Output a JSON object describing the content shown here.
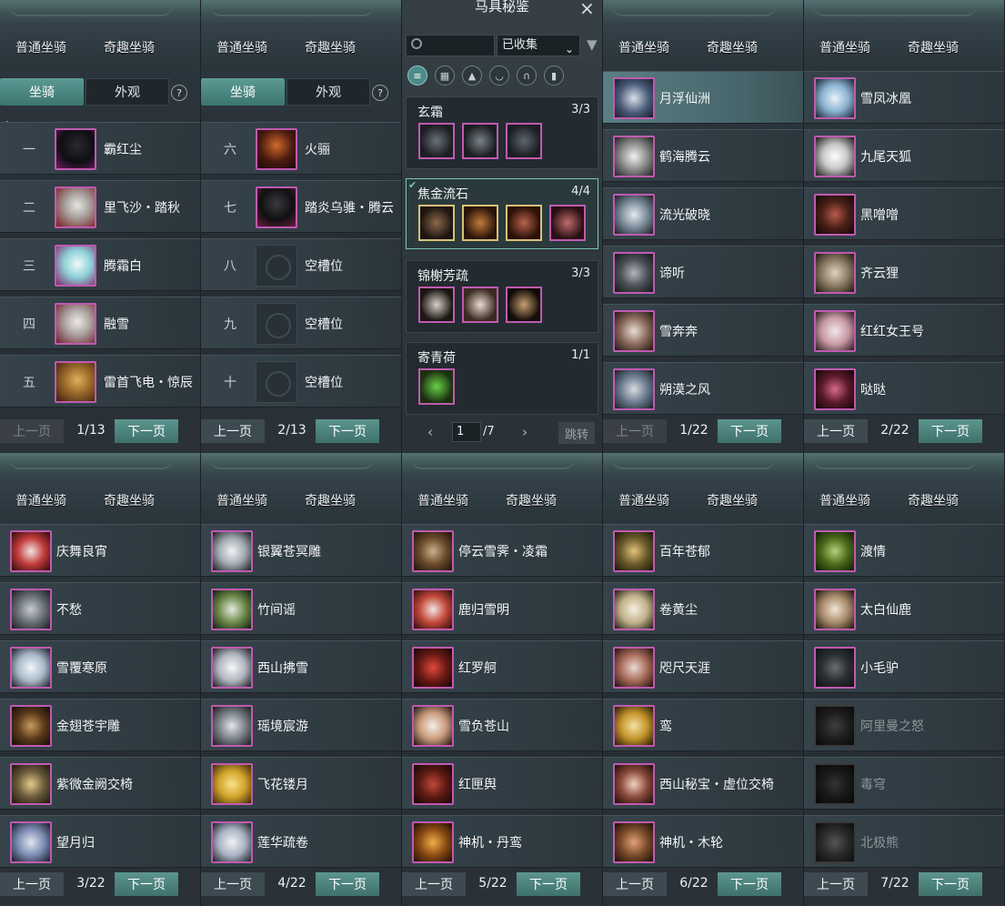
{
  "colors": {
    "accent": "#4f8a8a",
    "border_epic": "#c05ab0",
    "border_gold": "#d7c07a"
  },
  "common": {
    "tab_normal": "普通坐骑",
    "tab_fun": "奇趣坐骑",
    "sub_mount": "坐骑",
    "sub_look": "外观",
    "help": "?",
    "prev": "上一页",
    "next": "下一页"
  },
  "panels": [
    {
      "page": "1/13",
      "prev_disabled": true,
      "slots": [
        {
          "num": "一",
          "name": "霸红尘"
        },
        {
          "num": "二",
          "name": "里飞沙・踏秋"
        },
        {
          "num": "三",
          "name": "腾霜白"
        },
        {
          "num": "四",
          "name": "融雪"
        },
        {
          "num": "五",
          "name": "雷首飞电・惊辰"
        }
      ]
    },
    {
      "page": "2/13",
      "prev_disabled": false,
      "slots": [
        {
          "num": "六",
          "name": "火骊"
        },
        {
          "num": "七",
          "name": "踏炎乌骓・腾云"
        },
        {
          "num": "八",
          "name": "空槽位"
        },
        {
          "num": "九",
          "name": "空槽位"
        },
        {
          "num": "十",
          "name": "空槽位"
        }
      ]
    },
    {
      "page": "1/22",
      "prev_disabled": true,
      "items": [
        "月浮仙洲",
        "鹤海腾云",
        "流光破晓",
        "谛听",
        "雪奔奔",
        "朔漠之风"
      ]
    },
    {
      "page": "2/22",
      "prev_disabled": false,
      "items": [
        "雪凤冰凰",
        "九尾天狐",
        "黑噌噌",
        "齐云狸",
        "红红女王号",
        "哒哒"
      ]
    },
    {
      "page": "3/22",
      "prev_disabled": false,
      "items": [
        "庆舞良宵",
        "不愁",
        "雪覆寒原",
        "金翅苍宇雕",
        "紫微金阙交椅",
        "望月归"
      ]
    },
    {
      "page": "4/22",
      "prev_disabled": false,
      "items": [
        "银翼苍冥雕",
        "竹间谣",
        "西山拂雪",
        "瑶境宸游",
        "飞花镂月",
        "莲华疏卷"
      ]
    },
    {
      "page": "5/22",
      "prev_disabled": false,
      "items": [
        "停云雪霁・凌霜",
        "鹿归雪明",
        "红罗舸",
        "雪负苍山",
        "红匣舆",
        "神机・丹鸾"
      ]
    },
    {
      "page": "6/22",
      "prev_disabled": false,
      "items": [
        "百年苍郁",
        "卷黄尘",
        "咫尺天涯",
        "鸾",
        "西山秘宝・虚位交椅",
        "神机・木轮"
      ]
    },
    {
      "page": "7/22",
      "prev_disabled": false,
      "items": [
        "渡情",
        "太白仙鹿",
        "小毛驴",
        "阿里曼之怒",
        "毒穹",
        "北极熊"
      ]
    }
  ],
  "book": {
    "title": "马具秘鉴",
    "close": "×",
    "search_placeholder": "",
    "filter_value": "已收集",
    "sets": [
      {
        "name": "玄霜",
        "count": "3/3",
        "n": 3
      },
      {
        "name": "焦金流石",
        "count": "4/4",
        "n": 4
      },
      {
        "name": "锦榭芳疏",
        "count": "3/3",
        "n": 3
      },
      {
        "name": "寄青荷",
        "count": "1/1",
        "n": 1
      }
    ],
    "page_input": "1",
    "page_total": "/7",
    "jump": "跳转",
    "prev_arrow": "‹",
    "next_arrow": "›"
  }
}
